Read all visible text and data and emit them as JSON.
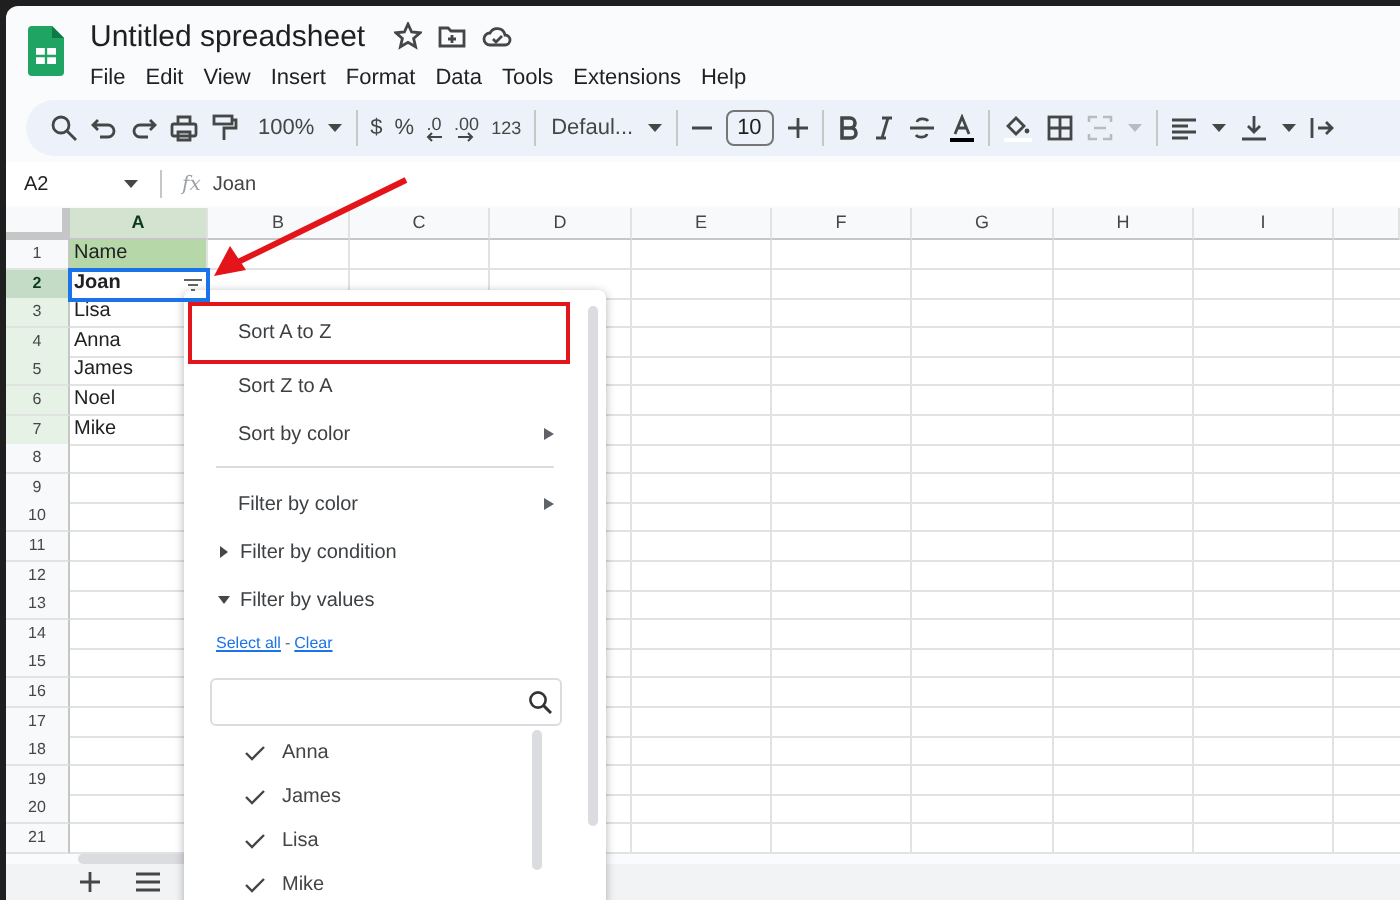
{
  "window": {
    "title": "Untitled spreadsheet"
  },
  "menu_bar": [
    "File",
    "Edit",
    "View",
    "Insert",
    "Format",
    "Data",
    "Tools",
    "Extensions",
    "Help"
  ],
  "toolbar": {
    "zoom": "100%",
    "currency": "$",
    "percent": "%",
    "decrease_decimals": ".0",
    "increase_decimals": ".00",
    "number_format": "123",
    "font": "Defaul...",
    "font_size": "10"
  },
  "formula_bar": {
    "cell_ref": "A2",
    "fx": "fx",
    "value": "Joan"
  },
  "grid": {
    "columns": [
      "A",
      "B",
      "C",
      "D",
      "E",
      "F",
      "G",
      "H",
      "I"
    ],
    "rows": [
      {
        "number": "1",
        "selected": false,
        "in_range": false,
        "cell": "Name",
        "header": true
      },
      {
        "number": "2",
        "selected": true,
        "in_range": false,
        "cell": "Joan",
        "header": false
      },
      {
        "number": "3",
        "selected": false,
        "in_range": true,
        "cell": "Lisa",
        "header": false
      },
      {
        "number": "4",
        "selected": false,
        "in_range": true,
        "cell": "Anna",
        "header": false
      },
      {
        "number": "5",
        "selected": false,
        "in_range": true,
        "cell": "James",
        "header": false
      },
      {
        "number": "6",
        "selected": false,
        "in_range": true,
        "cell": "Noel",
        "header": false
      },
      {
        "number": "7",
        "selected": false,
        "in_range": true,
        "cell": "Mike",
        "header": false
      },
      {
        "number": "8",
        "selected": false,
        "in_range": false
      },
      {
        "number": "9",
        "selected": false,
        "in_range": false
      },
      {
        "number": "10",
        "selected": false,
        "in_range": false
      },
      {
        "number": "11",
        "selected": false,
        "in_range": false
      },
      {
        "number": "12",
        "selected": false,
        "in_range": false
      },
      {
        "number": "13",
        "selected": false,
        "in_range": false
      },
      {
        "number": "14",
        "selected": false,
        "in_range": false
      },
      {
        "number": "15",
        "selected": false,
        "in_range": false
      },
      {
        "number": "16",
        "selected": false,
        "in_range": false
      },
      {
        "number": "17",
        "selected": false,
        "in_range": false
      },
      {
        "number": "18",
        "selected": false,
        "in_range": false
      },
      {
        "number": "19",
        "selected": false,
        "in_range": false
      },
      {
        "number": "20",
        "selected": false,
        "in_range": false
      },
      {
        "number": "21",
        "selected": false,
        "in_range": false
      }
    ]
  },
  "filter_menu": {
    "items": [
      {
        "kind": "action",
        "label": "Sort A to Z",
        "highlighted": true
      },
      {
        "kind": "action",
        "label": "Sort Z to A",
        "highlighted": false
      },
      {
        "kind": "submenu",
        "label": "Sort by color",
        "highlighted": false
      },
      {
        "kind": "divider"
      },
      {
        "kind": "submenu",
        "label": "Filter by color",
        "highlighted": false
      },
      {
        "kind": "section",
        "label": "Filter by condition",
        "expanded": false
      },
      {
        "kind": "section",
        "label": "Filter by values",
        "expanded": true
      }
    ],
    "links": {
      "select_all": "Select all",
      "separator": "-",
      "clear": "Clear"
    },
    "values": [
      {
        "label": "Anna",
        "checked": true
      },
      {
        "label": "James",
        "checked": true
      },
      {
        "label": "Lisa",
        "checked": true
      },
      {
        "label": "Mike",
        "checked": true
      }
    ]
  },
  "callout_arrow": true
}
